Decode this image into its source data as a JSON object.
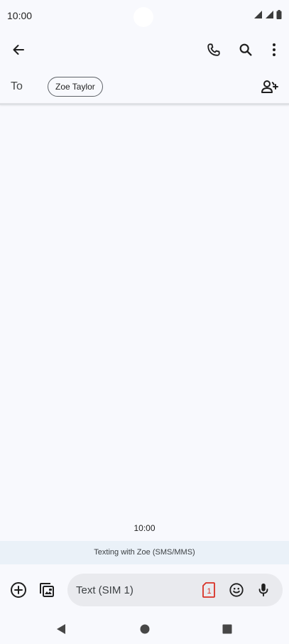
{
  "status_bar": {
    "time": "10:00",
    "icons": [
      "signal-icon",
      "signal-icon",
      "battery-icon"
    ]
  },
  "app_bar": {
    "icons": [
      "back-arrow-icon",
      "phone-icon",
      "search-icon",
      "more-vert-icon"
    ]
  },
  "recipients": {
    "to_label": "To",
    "chips": [
      "Zoe Taylor"
    ],
    "add_icon": "add-person-icon"
  },
  "conversation": {
    "timestamp": "10:00",
    "banner": "Texting with Zoe (SMS/MMS)"
  },
  "compose": {
    "placeholder": "Text (SIM 1)",
    "sim_badge": "1",
    "icons": [
      "add-circle-icon",
      "gallery-icon",
      "sim-card-icon",
      "emoji-icon",
      "mic-icon"
    ],
    "sim_color": "#d93025"
  },
  "nav_bar": {
    "icons": [
      "back-triangle-icon",
      "home-circle-icon",
      "recents-square-icon"
    ]
  }
}
